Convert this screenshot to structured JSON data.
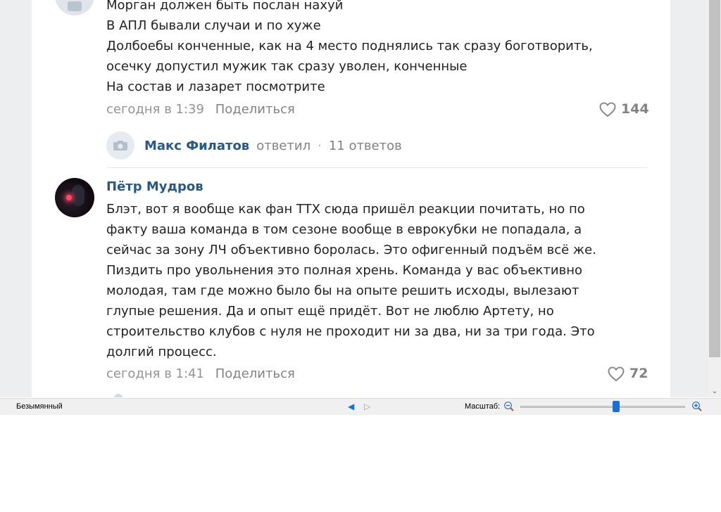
{
  "comment1": {
    "lines": [
      "Морган должен быть послан нахуй",
      "В АПЛ бывали случаи и по хуже",
      "Долбоебы конченные, как на 4 место поднялись так сразу боготворить,",
      "осечку допустил мужик так сразу уволен, конченные",
      "На состав и лазарет посмотрите"
    ],
    "time": "сегодня в 1:39",
    "share": "Поделиться",
    "likes": "144"
  },
  "reply_summary": {
    "author": "Макс Филатов",
    "verb": "ответил",
    "separator": "·",
    "count": "11 ответов"
  },
  "comment2": {
    "author": "Пётр Мудров",
    "lines": [
      "Блэт, вот я вообще как фан TTX сюда пришёл реакции почитать, но по",
      "факту ваша команда в том сезоне вообще в еврокубки не попадала, а",
      "сейчас за зону ЛЧ объективно боролась. Это офигенный подъём всё же.",
      "Пиздить про увольнения это полная хрень. Команда у вас объективно",
      "молодая, там где можно было бы на опыте решить исходы, вылезают",
      "глупые решения. Да и опыт ещё придёт. Вот не люблю Артету, но",
      "строительство клубов с нуля не проходит ни за два, ни за три года. Это",
      "долгий процесс."
    ],
    "time": "сегодня в 1:41",
    "share": "Поделиться",
    "likes": "72"
  },
  "statusbar": {
    "filename": "Безымянный",
    "zoom_label": "Масштаб:",
    "prev_arrow": "◀",
    "next_arrow": "▷"
  },
  "scrollbar": {
    "down_arrow": "⌄"
  },
  "icons": {
    "heart": "heart-icon",
    "camera": "camera-icon",
    "zoom_out": "zoom-out-icon",
    "zoom_in": "zoom-in-icon"
  },
  "colors": {
    "link": "#2a5885",
    "meta": "#939393",
    "text": "#222222",
    "accent": "#1c6fd1"
  },
  "zoom_level_fraction": 0.58
}
